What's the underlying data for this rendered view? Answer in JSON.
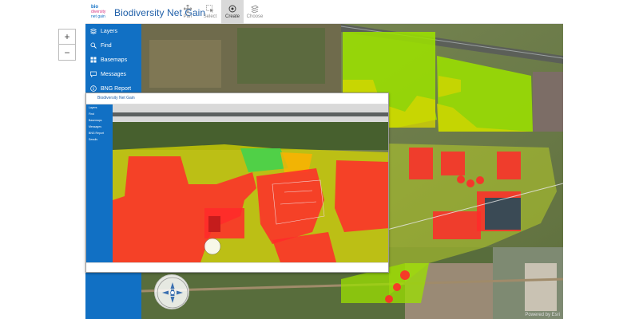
{
  "app": {
    "title": "Biodiversity Net Gain",
    "logo_lines": [
      "bio",
      "diversity",
      "net gain"
    ]
  },
  "toolbar": {
    "tools": [
      {
        "label": "Pan",
        "icon": "move-icon",
        "active": false
      },
      {
        "label": "Select",
        "icon": "cursor-icon",
        "active": false
      },
      {
        "label": "Create",
        "icon": "target-icon",
        "active": true
      },
      {
        "label": "Choose",
        "icon": "layers-stack-icon",
        "active": false
      }
    ]
  },
  "sidebar": {
    "items": [
      {
        "label": "Layers",
        "icon": "layers-icon"
      },
      {
        "label": "Find",
        "icon": "search-icon"
      },
      {
        "label": "Basemaps",
        "icon": "grid-icon"
      },
      {
        "label": "Messages",
        "icon": "message-icon"
      },
      {
        "label": "BNG Report",
        "icon": "info-icon"
      }
    ]
  },
  "map": {
    "zoom_in": "+",
    "zoom_out": "−",
    "attribution": "Powered by Esri"
  },
  "inset": {
    "title": "Biodiversity Net Gain",
    "sidebar": [
      "Layers",
      "Find",
      "Basemaps",
      "Messages",
      "BNG Report",
      "Sessils"
    ],
    "toolbar": [
      "Pan",
      "Select",
      "Create",
      "Choose"
    ]
  },
  "colors": {
    "brand": "#1170c4",
    "title": "#1f5fa8",
    "habitat_green": "#9be000",
    "habitat_yellow": "#d6d600",
    "habitat_red": "#ff2a2a"
  }
}
